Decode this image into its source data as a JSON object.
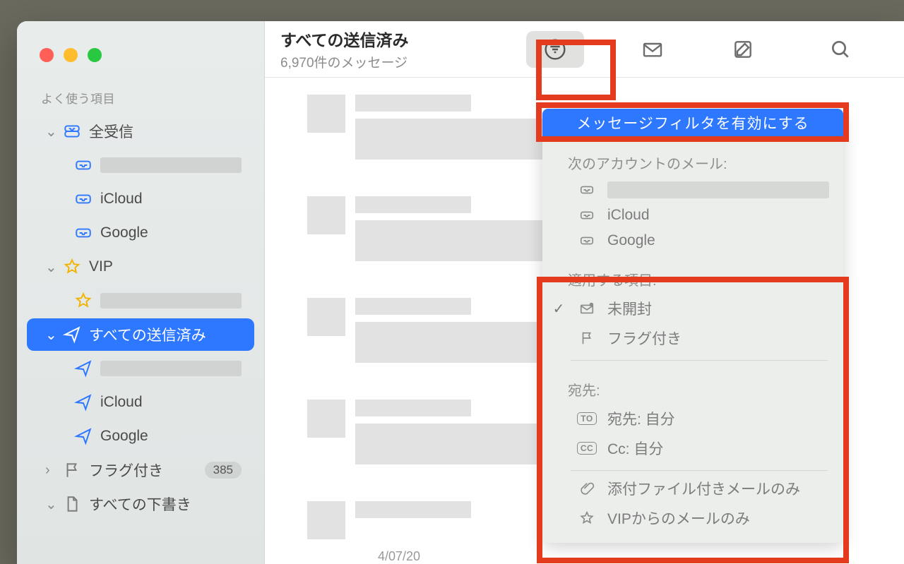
{
  "sidebar": {
    "heading": "よく使う項目",
    "groups": [
      {
        "id": "all-inboxes",
        "label": "全受信",
        "icon": "inbox-stack",
        "expanded": true,
        "children": [
          {
            "id": "acct1",
            "label": "",
            "redacted": true,
            "icon": "inbox"
          },
          {
            "id": "icloud",
            "label": "iCloud",
            "icon": "inbox"
          },
          {
            "id": "google",
            "label": "Google",
            "icon": "inbox"
          }
        ]
      },
      {
        "id": "vip",
        "label": "VIP",
        "icon": "star",
        "expanded": true,
        "children": [
          {
            "id": "vip1",
            "label": "",
            "redacted": true,
            "icon": "star"
          }
        ]
      },
      {
        "id": "all-sent",
        "label": "すべての送信済み",
        "icon": "paperplane",
        "selected": true,
        "expanded": true,
        "children": [
          {
            "id": "sent1",
            "label": "",
            "redacted": true,
            "icon": "paperplane"
          },
          {
            "id": "sent-icloud",
            "label": "iCloud",
            "icon": "paperplane"
          },
          {
            "id": "sent-google",
            "label": "Google",
            "icon": "paperplane"
          }
        ]
      },
      {
        "id": "flagged",
        "label": "フラグ付き",
        "icon": "flag",
        "badge": "385",
        "expanded": false
      },
      {
        "id": "drafts",
        "label": "すべての下書き",
        "icon": "doc",
        "expanded": true
      }
    ]
  },
  "header": {
    "title": "すべての送信済み",
    "subtitle": "6,970件のメッセージ"
  },
  "toolbar": {
    "filter": "filter-icon",
    "inbox": "envelope-icon",
    "compose": "compose-icon",
    "search": "search-icon",
    "archive": "archivebox-icon"
  },
  "filter_popover": {
    "enable_label": "メッセージフィルタを有効にする",
    "section_account_label": "次のアカウントのメール:",
    "accounts": [
      {
        "id": "acct1",
        "label": "",
        "redacted": true
      },
      {
        "id": "icloud",
        "label": "iCloud"
      },
      {
        "id": "google",
        "label": "Google"
      }
    ],
    "section_apply_label": "適用する項目:",
    "apply_items": [
      {
        "id": "unread",
        "label": "未開封",
        "icon": "envelope-badge",
        "checked": true
      },
      {
        "id": "flagged",
        "label": "フラグ付き",
        "icon": "flag",
        "checked": false
      }
    ],
    "section_addressed_label": "宛先:",
    "addressed_items": [
      {
        "id": "to-me",
        "tag": "TO",
        "label": "宛先: 自分"
      },
      {
        "id": "cc-me",
        "tag": "CC",
        "label": "Cc: 自分"
      }
    ],
    "extras": [
      {
        "id": "has-attach",
        "icon": "paperclip",
        "label": "添付ファイル付きメールのみ"
      },
      {
        "id": "from-vip",
        "icon": "star",
        "label": "VIPからのメールのみ"
      }
    ]
  },
  "message_list": {
    "visible_date_fragment": "4/07/20"
  }
}
